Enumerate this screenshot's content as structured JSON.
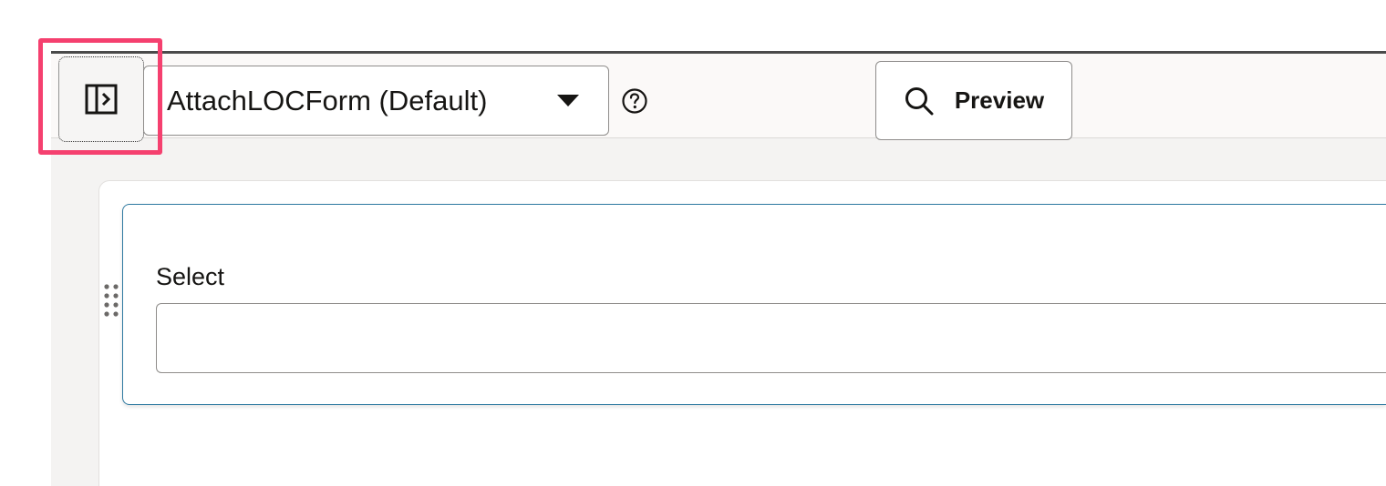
{
  "toolbar": {
    "layout_select": {
      "value": "AttachLOCForm (Default)"
    },
    "preview_label": "Preview"
  },
  "canvas": {
    "field": {
      "label": "Select",
      "value": ""
    }
  },
  "icons": {
    "panel_toggle": "sidebar-expand-icon",
    "help": "question-circle-icon",
    "preview": "search-icon",
    "drag": "drag-handle-icon",
    "dropdown": "caret-down-icon"
  },
  "colors": {
    "highlight": "#f5406f",
    "card_border": "#2f7aa1",
    "toolbar_bg": "#fbf9f8",
    "editor_bg": "#f4f3f2"
  }
}
